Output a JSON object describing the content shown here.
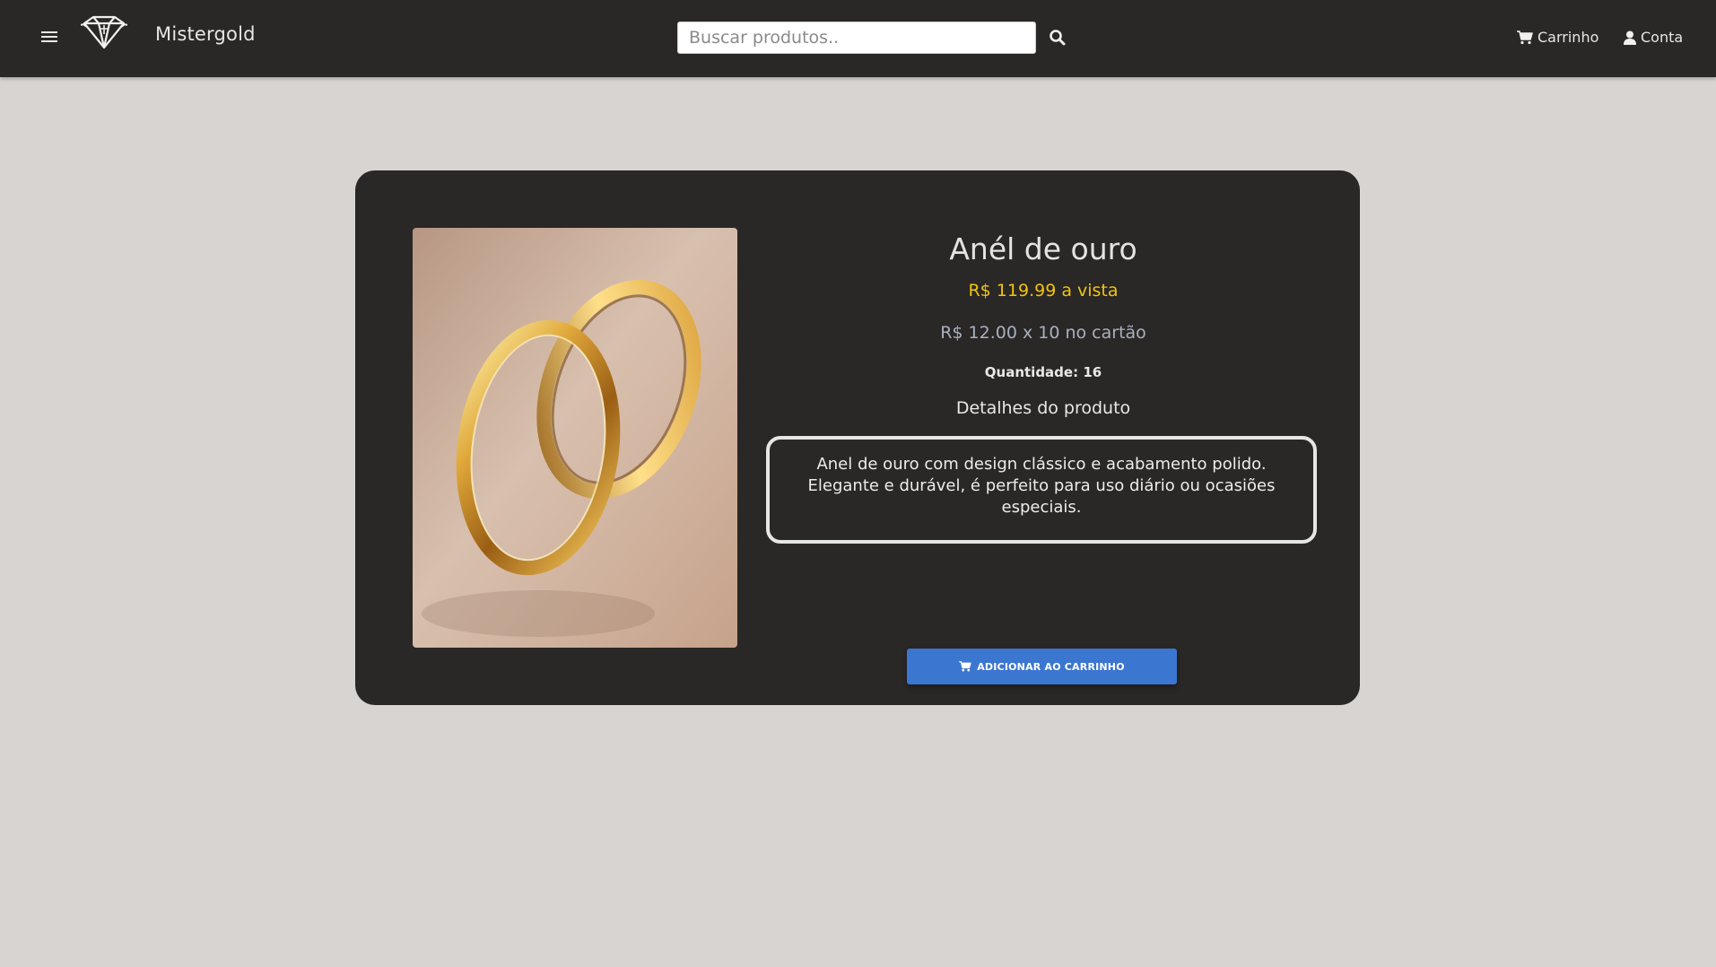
{
  "navbar": {
    "menu_icon": "hamburger-menu-icon",
    "logo_icon": "diamond-logo-icon",
    "brand": "Mistergold",
    "search_placeholder": "Buscar produtos..",
    "search_icon": "search-icon",
    "cart_icon": "cart-icon",
    "cart_label": "Carrinho",
    "account_icon": "user-icon",
    "account_label": "Conta"
  },
  "product": {
    "image_icon": "gold-rings-image",
    "title": "Anél de ouro",
    "price_cash": "R$ 119.99 a vista",
    "price_installments": "R$ 12.00 x 10 no cartão",
    "quantity": "Quantidade: 16",
    "details_heading": "Detalhes do produto",
    "description": "Anel de ouro com design clássico e acabamento polido. Elegante e durável, é perfeito para uso diário ou ocasiões especiais.",
    "add_to_cart_label": "ADICIONAR AO CARRINHO"
  },
  "colors": {
    "navbar_bg": "#2a2727",
    "page_bg": "#d8d4d1",
    "card_bg": "#2a2727",
    "price_accent": "#f1c40f",
    "button_blue": "#3b76d0"
  }
}
